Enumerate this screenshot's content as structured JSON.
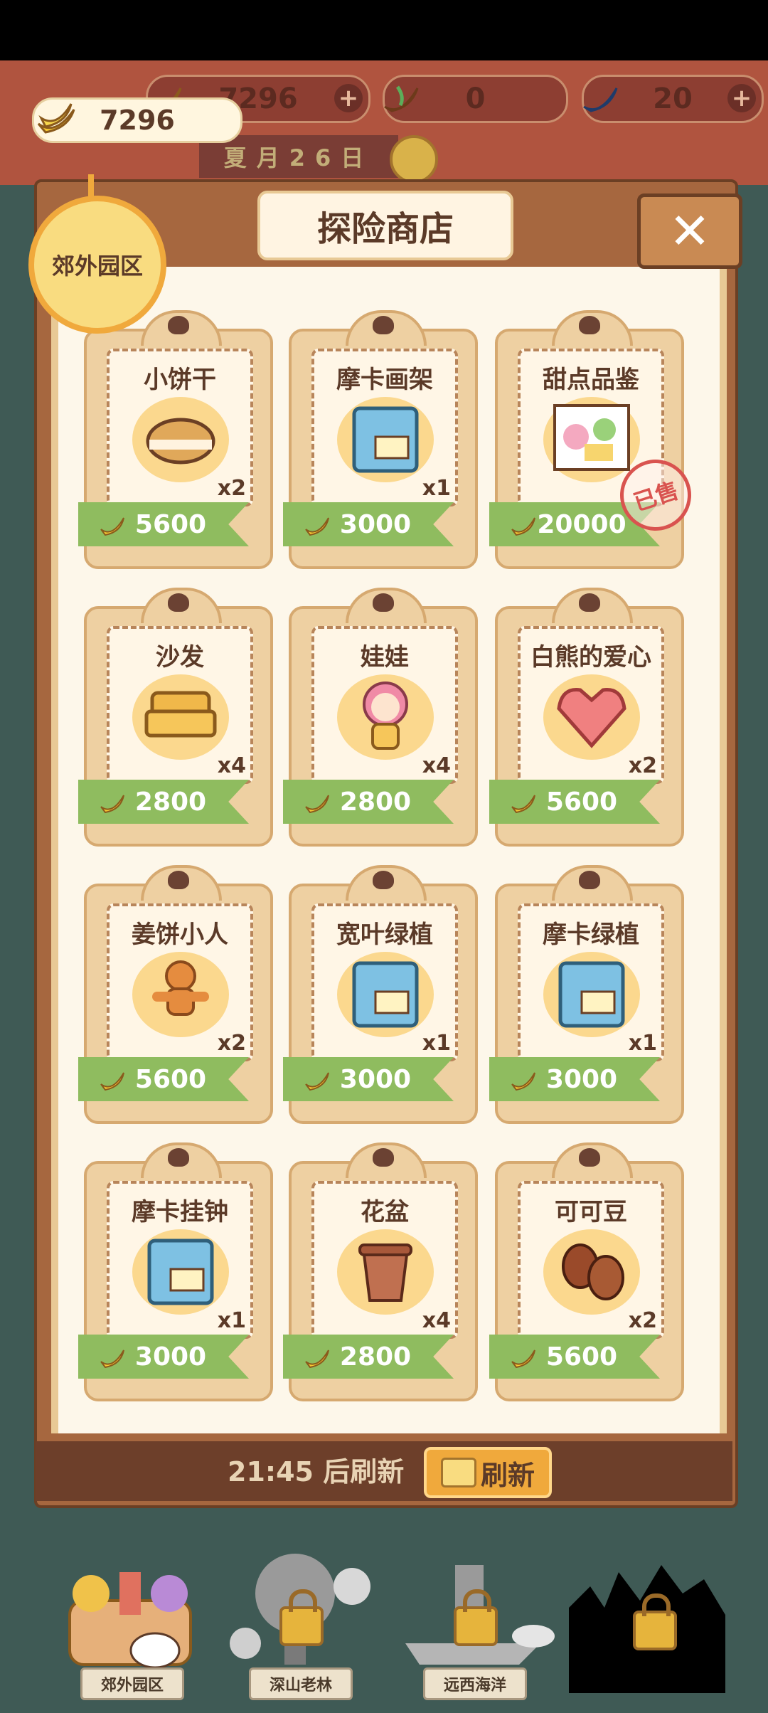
{
  "hud": {
    "banana_count": "7296",
    "banana_pill": "7296",
    "fire_count": "0",
    "blue_count": "20",
    "date": "夏月26日"
  },
  "shop": {
    "title": "探险商店",
    "area_badge": "郊外园区",
    "refresh_timer": "21:45 后刷新",
    "refresh_button": "刷新",
    "sold_stamp": "已售",
    "items": [
      {
        "name": "小饼干",
        "qty": "x2",
        "price": "5600",
        "icon": "cookie-icon"
      },
      {
        "name": "摩卡画架",
        "qty": "x1",
        "price": "3000",
        "icon": "blueprint-icon"
      },
      {
        "name": "甜点品鉴",
        "qty": "",
        "price": "20000",
        "icon": "dessert-picture-icon",
        "sold": true
      },
      {
        "name": "沙发",
        "qty": "x4",
        "price": "2800",
        "icon": "sofa-icon"
      },
      {
        "name": "娃娃",
        "qty": "x4",
        "price": "2800",
        "icon": "doll-icon"
      },
      {
        "name": "白熊的爱心",
        "qty": "x2",
        "price": "5600",
        "icon": "heart-gem-icon"
      },
      {
        "name": "姜饼小人",
        "qty": "x2",
        "price": "5600",
        "icon": "gingerbread-icon"
      },
      {
        "name": "宽叶绿植",
        "qty": "x1",
        "price": "3000",
        "icon": "blueprint-icon"
      },
      {
        "name": "摩卡绿植",
        "qty": "x1",
        "price": "3000",
        "icon": "blueprint-icon"
      },
      {
        "name": "摩卡挂钟",
        "qty": "x1",
        "price": "3000",
        "icon": "blueprint-icon"
      },
      {
        "name": "花盆",
        "qty": "x4",
        "price": "2800",
        "icon": "flowerpot-icon"
      },
      {
        "name": "可可豆",
        "qty": "x2",
        "price": "5600",
        "icon": "cocoa-bean-icon"
      }
    ]
  },
  "locations": [
    {
      "label": "郊外园区",
      "locked": false
    },
    {
      "label": "深山老林",
      "locked": true
    },
    {
      "label": "远西海洋",
      "locked": true
    },
    {
      "label": "",
      "locked": true
    }
  ],
  "colors": {
    "ribbon_green": "#8fbc5f",
    "card_tan": "#eed0a2",
    "board_brown": "#a6673f",
    "hud_red": "#b0543f"
  }
}
